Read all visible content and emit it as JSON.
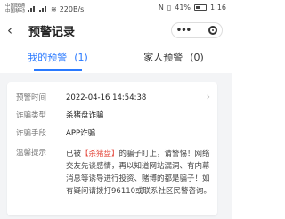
{
  "status_bar": {
    "carrier_1": "中国联通",
    "carrier_2": "中国移动",
    "network_speed": "220B/s",
    "battery": "41%",
    "time": "1:16"
  },
  "header": {
    "title": "预警记录",
    "back_icon": "back-arrow-icon"
  },
  "tabs": [
    {
      "label": "我的预警",
      "count": "(1)",
      "active": true
    },
    {
      "label": "家人预警",
      "count": "(0)",
      "active": false
    }
  ],
  "record": {
    "time_label": "预警时间",
    "time_value": "2022-04-16 14:54:38",
    "type_label": "诈骗类型",
    "type_value": "杀猪盘诈骗",
    "means_label": "诈骗手段",
    "means_value": "APP诈骗",
    "tip_label": "温馨提示",
    "tip_prefix": "已被",
    "tip_highlight": "【杀猪盘】",
    "tip_text": "的骗子盯上，请警惕！网络交友先谈感情，再以知道网站漏洞、有内幕消息等诱导进行投资、赌博的都是骗子！如有疑问请拨打96110或联系社区民警咨询。"
  },
  "colors": {
    "accent": "#2979ff",
    "highlight": "#e54d42",
    "background": "#f3f4f6"
  }
}
